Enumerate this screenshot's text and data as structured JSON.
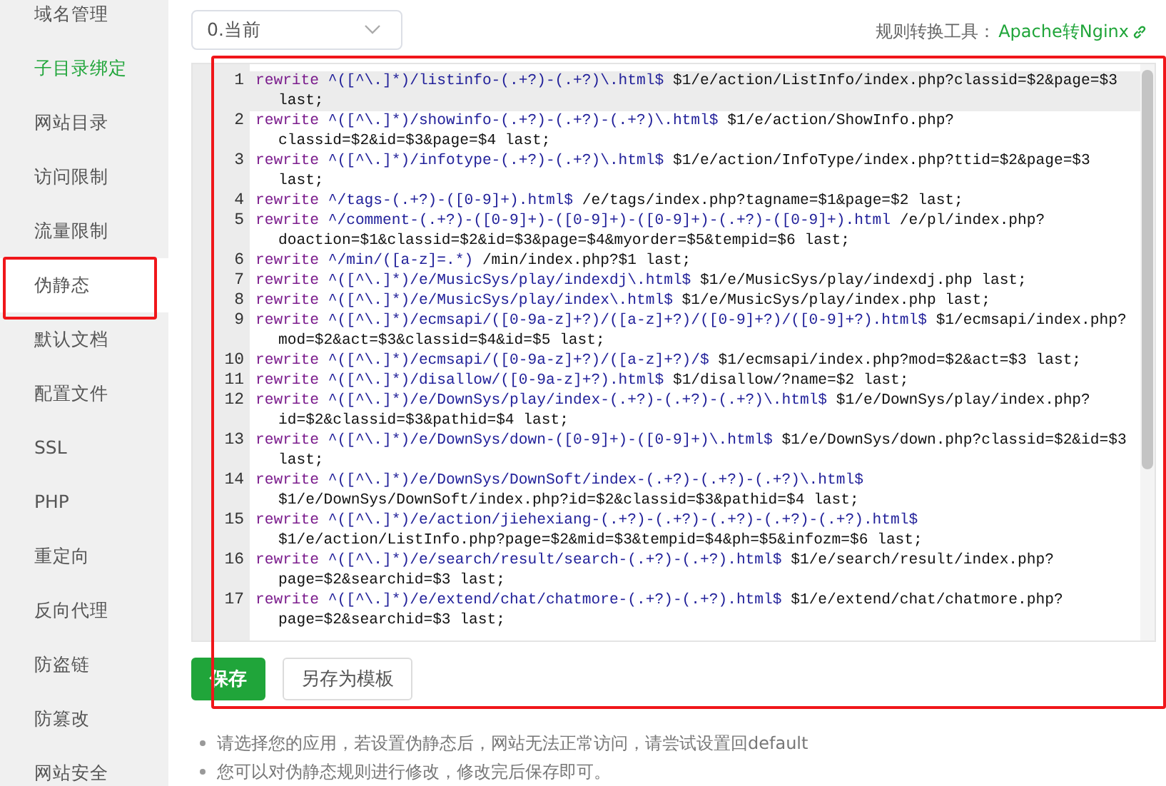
{
  "sidebar": {
    "items": [
      {
        "label": "域名管理",
        "selected": false,
        "hovered": false,
        "marked": false
      },
      {
        "label": "子目录绑定",
        "selected": false,
        "hovered": true,
        "marked": false
      },
      {
        "label": "网站目录",
        "selected": false,
        "hovered": false,
        "marked": false
      },
      {
        "label": "访问限制",
        "selected": false,
        "hovered": false,
        "marked": false
      },
      {
        "label": "流量限制",
        "selected": false,
        "hovered": false,
        "marked": false
      },
      {
        "label": "伪静态",
        "selected": true,
        "hovered": false,
        "marked": true
      },
      {
        "label": "默认文档",
        "selected": false,
        "hovered": false,
        "marked": false
      },
      {
        "label": "配置文件",
        "selected": false,
        "hovered": false,
        "marked": false
      },
      {
        "label": "SSL",
        "selected": false,
        "hovered": false,
        "marked": false
      },
      {
        "label": "PHP",
        "selected": false,
        "hovered": false,
        "marked": false
      },
      {
        "label": "重定向",
        "selected": false,
        "hovered": false,
        "marked": false
      },
      {
        "label": "反向代理",
        "selected": false,
        "hovered": false,
        "marked": false
      },
      {
        "label": "防盗链",
        "selected": false,
        "hovered": false,
        "marked": false
      },
      {
        "label": "防篡改",
        "selected": false,
        "hovered": false,
        "marked": false
      },
      {
        "label": "网站安全",
        "selected": false,
        "hovered": false,
        "marked": false
      }
    ]
  },
  "version_select": {
    "value": "0.当前"
  },
  "converter": {
    "label": "规则转换工具：",
    "link": "Apache转Nginx"
  },
  "editor": {
    "marked": true,
    "lines": [
      {
        "number": "1",
        "keyword": "rewrite",
        "pattern": "^([^\\.]*)/listinfo-(.+?)-(.+?)\\.html$",
        "target": "$1/e/action/ListInfo/index.php?classid=$2&page=$3 last;",
        "active": true
      },
      {
        "number": "2",
        "keyword": "rewrite",
        "pattern": "^([^\\.]*)/showinfo-(.+?)-(.+?)-(.+?)\\.html$",
        "target": "$1/e/action/ShowInfo.php?classid=$2&id=$3&page=$4 last;",
        "active": false
      },
      {
        "number": "3",
        "keyword": "rewrite",
        "pattern": "^([^\\.]*)/infotype-(.+?)-(.+?)\\.html$",
        "target": "$1/e/action/InfoType/index.php?ttid=$2&page=$3 last;",
        "active": false
      },
      {
        "number": "4",
        "keyword": "rewrite",
        "pattern": "^/tags-(.+?)-([0-9]+).html$",
        "target": "/e/tags/index.php?tagname=$1&page=$2 last;",
        "active": false
      },
      {
        "number": "5",
        "keyword": "rewrite",
        "pattern": "^/comment-(.+?)-([0-9]+)-([0-9]+)-([0-9]+)-(.+?)-([0-9]+).html",
        "target": "/e/pl/index.php?doaction=$1&classid=$2&id=$3&page=$4&myorder=$5&tempid=$6 last;",
        "active": false
      },
      {
        "number": "6",
        "keyword": "rewrite",
        "pattern": "^/min/([a-z]=.*)",
        "target": "/min/index.php?$1 last;",
        "active": false
      },
      {
        "number": "7",
        "keyword": "rewrite",
        "pattern": "^([^\\.]*)/e/MusicSys/play/indexdj\\.html$",
        "target": "$1/e/MusicSys/play/indexdj.php last;",
        "active": false
      },
      {
        "number": "8",
        "keyword": "rewrite",
        "pattern": "^([^\\.]*)/e/MusicSys/play/index\\.html$",
        "target": "$1/e/MusicSys/play/index.php last;",
        "active": false
      },
      {
        "number": "9",
        "keyword": "rewrite",
        "pattern": "^([^\\.]*)/ecmsapi/([0-9a-z]+?)/([a-z]+?)/([0-9]+?)/([0-9]+?).html$",
        "target": "$1/ecmsapi/index.php?mod=$2&act=$3&classid=$4&id=$5 last;",
        "active": false
      },
      {
        "number": "10",
        "keyword": "rewrite",
        "pattern": "^([^\\.]*)/ecmsapi/([0-9a-z]+?)/([a-z]+?)/$",
        "target": "$1/ecmsapi/index.php?mod=$2&act=$3 last;",
        "active": false
      },
      {
        "number": "11",
        "keyword": "rewrite",
        "pattern": "^([^\\.]*)/disallow/([0-9a-z]+?).html$",
        "target": "$1/disallow/?name=$2 last;",
        "active": false
      },
      {
        "number": "12",
        "keyword": "rewrite",
        "pattern": "^([^\\.]*)/e/DownSys/play/index-(.+?)-(.+?)-(.+?)\\.html$",
        "target": "$1/e/DownSys/play/index.php?id=$2&classid=$3&pathid=$4 last;",
        "active": false
      },
      {
        "number": "13",
        "keyword": "rewrite",
        "pattern": "^([^\\.]*)/e/DownSys/down-([0-9]+)-([0-9]+)\\.html$",
        "target": "$1/e/DownSys/down.php?classid=$2&id=$3 last;",
        "active": false
      },
      {
        "number": "14",
        "keyword": "rewrite",
        "pattern": "^([^\\.]*)/e/DownSys/DownSoft/index-(.+?)-(.+?)-(.+?)\\.html$",
        "target": "$1/e/DownSys/DownSoft/index.php?id=$2&classid=$3&pathid=$4 last;",
        "active": false
      },
      {
        "number": "15",
        "keyword": "rewrite",
        "pattern": "^([^\\.]*)/e/action/jiehexiang-(.+?)-(.+?)-(.+?)-(.+?)-(.+?).html$",
        "target": "$1/e/action/ListInfo.php?page=$2&mid=$3&tempid=$4&ph=$5&infozm=$6 last;",
        "active": false
      },
      {
        "number": "16",
        "keyword": "rewrite",
        "pattern": "^([^\\.]*)/e/search/result/search-(.+?)-(.+?).html$",
        "target": "$1/e/search/result/index.php?page=$2&searchid=$3 last;",
        "active": false
      },
      {
        "number": "17",
        "keyword": "rewrite",
        "pattern": "^([^\\.]*)/e/extend/chat/chatmore-(.+?)-(.+?).html$",
        "target": "$1/e/extend/chat/chatmore.php?page=$2&searchid=$3 last;",
        "active": false
      }
    ]
  },
  "buttons": [
    {
      "label": "保存",
      "kind": "primary"
    },
    {
      "label": "另存为模板",
      "kind": "default"
    }
  ],
  "notes": [
    "请选择您的应用，若设置伪静态后，网站无法正常访问，请尝试设置回default",
    "您可以对伪静态规则进行修改，修改完后保存即可。"
  ]
}
